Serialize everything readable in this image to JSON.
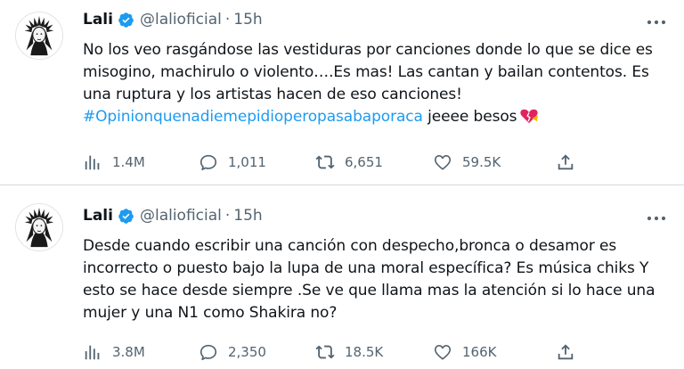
{
  "tweets": [
    {
      "name": "Lali",
      "handle": "@lalioficial",
      "separator": "·",
      "time": "15h",
      "text": "No los veo rasgándose las vestiduras por canciones donde lo que se dice es misogino, machirulo o violento….Es mas! Las cantan y bailan contentos. Es una ruptura y los artistas hacen de eso canciones!",
      "hashtag": "#Opinionquenadiemepidioperopasabaporaca",
      "text_tail": " jeeee besos",
      "views": "1.4M",
      "replies": "1,011",
      "retweets": "6,651",
      "likes": "59.5K"
    },
    {
      "name": "Lali",
      "handle": "@lalioficial",
      "separator": "·",
      "time": "15h",
      "text": "Desde cuando escribir una canción con despecho,bronca o desamor es incorrecto o puesto bajo la lupa de una moral específica? Es música chiks Y esto se hace desde siempre .Se ve que llama mas la atención si lo hace una mujer y una N1 como Shakira no?",
      "views": "3.8M",
      "replies": "2,350",
      "retweets": "18.5K",
      "likes": "166K"
    }
  ],
  "icons": {
    "verified": "verified-badge-icon",
    "more": "more-dots-icon",
    "views": "views-bars-icon",
    "reply": "reply-bubble-icon",
    "retweet": "retweet-icon",
    "like": "heart-icon",
    "share": "share-icon",
    "emoji": "broken-heart-emoji"
  },
  "colors": {
    "accent": "#1d9bf0",
    "text": "#0f1419",
    "secondary": "#536471",
    "divider": "#d4dadf"
  }
}
